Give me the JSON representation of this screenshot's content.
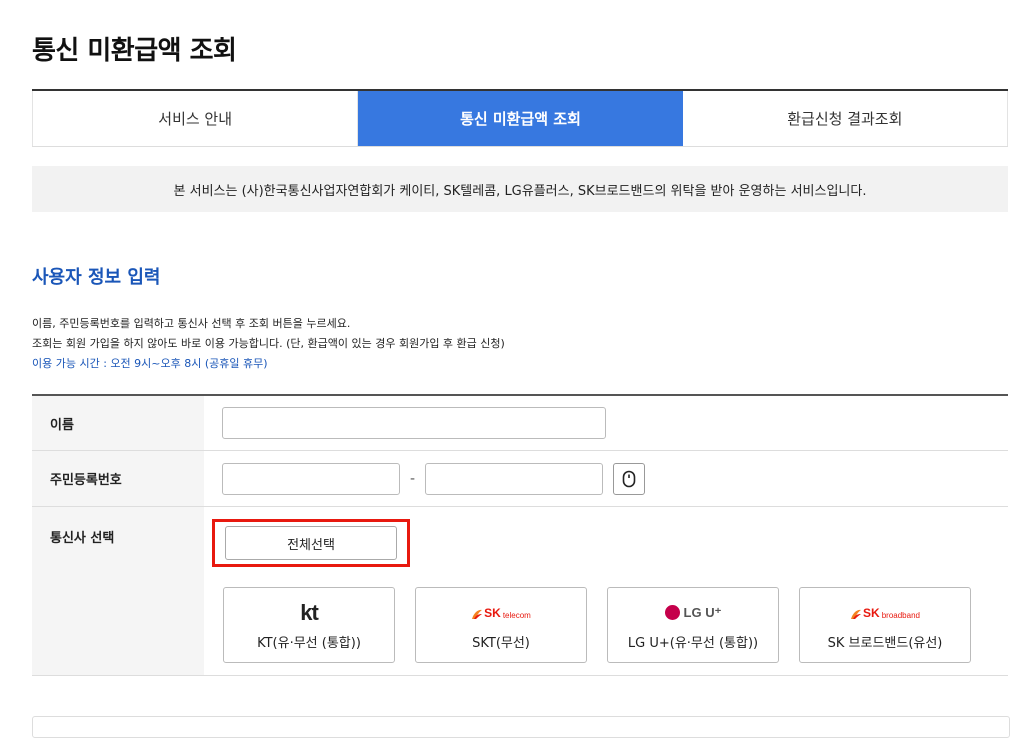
{
  "page": {
    "title": "통신 미환급액 조회"
  },
  "tabs": [
    {
      "label": "서비스 안내"
    },
    {
      "label": "통신 미환급액 조회",
      "active": true
    },
    {
      "label": "환급신청 결과조회"
    }
  ],
  "notice": {
    "text": "본 서비스는 (사)한국통신사업자연합회가 케이티, SK텔레콤, LG유플러스, SK브로드밴드의 위탁을 받아 운영하는 서비스입니다."
  },
  "section": {
    "title": "사용자 정보 입력",
    "desc1": "이름, 주민등록번호를 입력하고 통신사 선택 후 조회 버튼을 누르세요.",
    "desc2": "조회는 회원 가입을 하지 않아도 바로 이용 가능합니다. (단, 환급액이 있는 경우 회원가입 후 환급 신청)",
    "desc3": "이용 가능 시간 : 오전 9시~오후 8시 (공휴일 휴무)"
  },
  "form": {
    "name_label": "이름",
    "name_value": "",
    "rrn_label": "주민등록번호",
    "rrn_front": "",
    "rrn_dash": "-",
    "rrn_back": "",
    "carrier_label": "통신사 선택",
    "select_all": "전체선택"
  },
  "carriers": [
    {
      "logo": "kt",
      "name": "KT(유·무선 (통합))"
    },
    {
      "logo_main": "SK",
      "logo_sub": "telecom",
      "name": "SKT(무선)"
    },
    {
      "logo": "LG U⁺",
      "name": "LG U+(유·무선 (통합))"
    },
    {
      "logo_main": "SK",
      "logo_sub": "broadband",
      "name": "SK 브로드밴드(유선)"
    }
  ],
  "colors": {
    "accent": "#3778e0",
    "heading_blue": "#1a56b8",
    "highlight": "#e8190f"
  },
  "icons": {
    "keypad": "mouse-keypad-icon",
    "lg": "lg-circle-icon"
  }
}
